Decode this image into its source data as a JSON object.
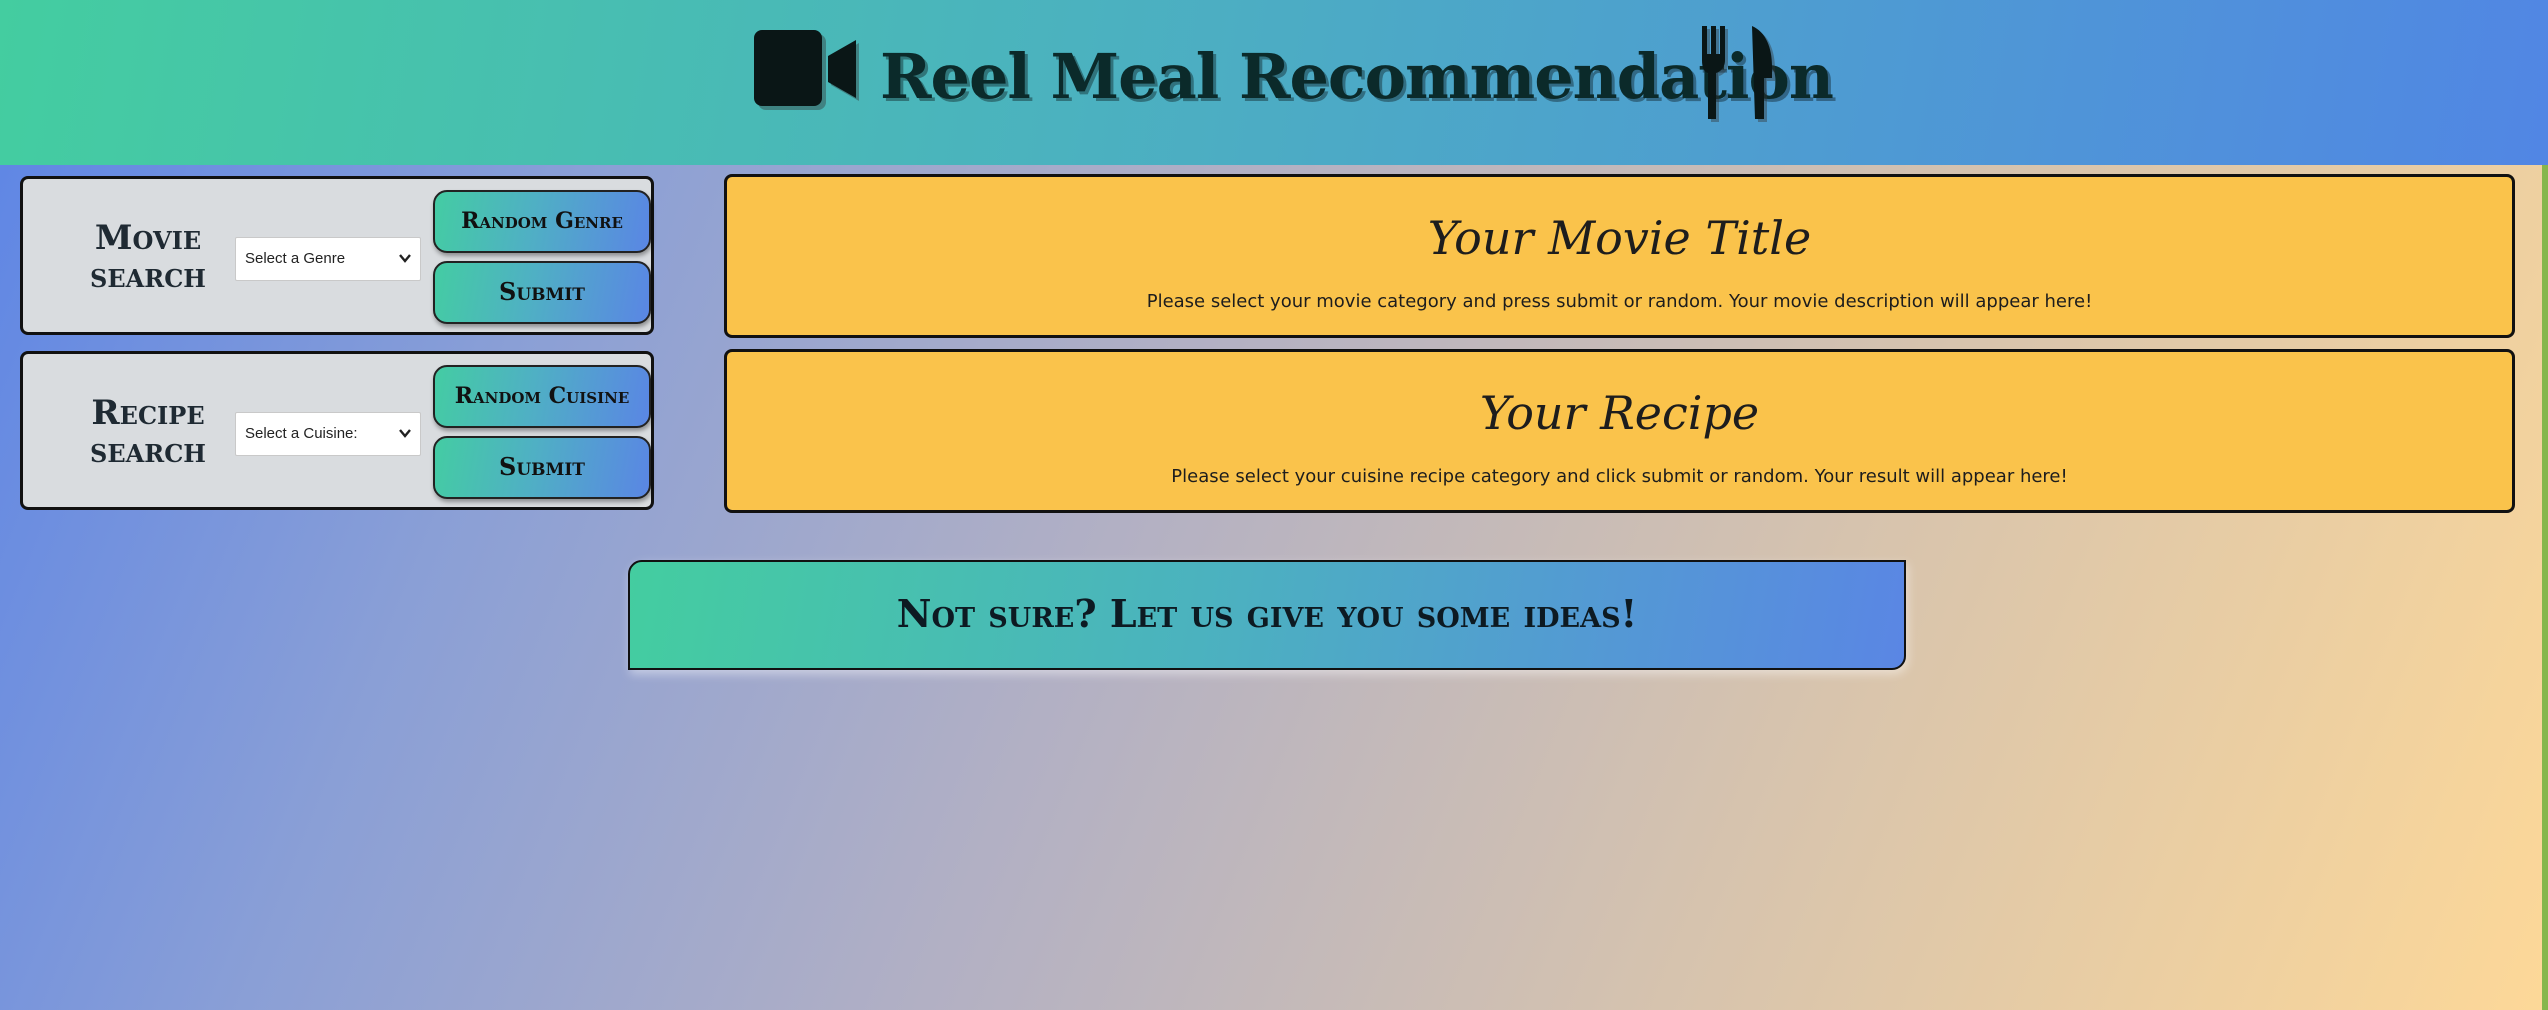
{
  "header": {
    "title": "Reel Meal Recommendation",
    "left_icon": "video-camera-icon",
    "right_icon": "utensils-icon"
  },
  "movie_search": {
    "label_line1": "Movie",
    "label_line2": "search",
    "select_value": "Select a Genre",
    "random_button": "Random Genre",
    "submit_button": "Submit"
  },
  "recipe_search": {
    "label_line1": "Recipe",
    "label_line2": "search",
    "select_value": "Select a Cuisine:",
    "random_button": "Random Cuisine",
    "submit_button": "Submit"
  },
  "movie_result": {
    "title": "Your Movie Title",
    "description": "Please select your movie category and press submit or random. Your movie description will appear here!"
  },
  "recipe_result": {
    "title": "Your Recipe",
    "description": "Please select your cuisine recipe category and click submit or random. Your result will appear here!"
  },
  "ideas_button": "Not sure? Let us give you some ideas!",
  "colors": {
    "header_gradient_start": "#44cda0",
    "header_gradient_end": "#5186e4",
    "result_panel": "#fac34b",
    "search_panel": "#d9dcdf"
  }
}
